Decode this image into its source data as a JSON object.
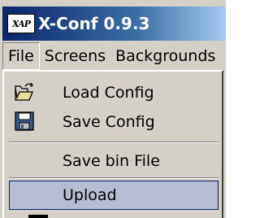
{
  "window": {
    "title": "X-Conf 0.9.3",
    "icon_text": "XAP",
    "icon": "app-logo-icon"
  },
  "menubar": {
    "items": [
      {
        "label": "File",
        "open": true
      },
      {
        "label": "Screens"
      },
      {
        "label": "Backgrounds"
      }
    ]
  },
  "file_menu": {
    "items": [
      {
        "label": "Load Config",
        "icon": "open-folder-icon"
      },
      {
        "label": "Save Config",
        "icon": "floppy-disk-icon"
      },
      {
        "label": "Save bin File"
      },
      {
        "label": "Upload",
        "highlighted": true
      }
    ]
  },
  "colors": {
    "title_bar_start": "#0a246a",
    "title_bar_end": "#a6caf0",
    "highlight": "#b6bdd2",
    "face": "#d4d0c8"
  }
}
